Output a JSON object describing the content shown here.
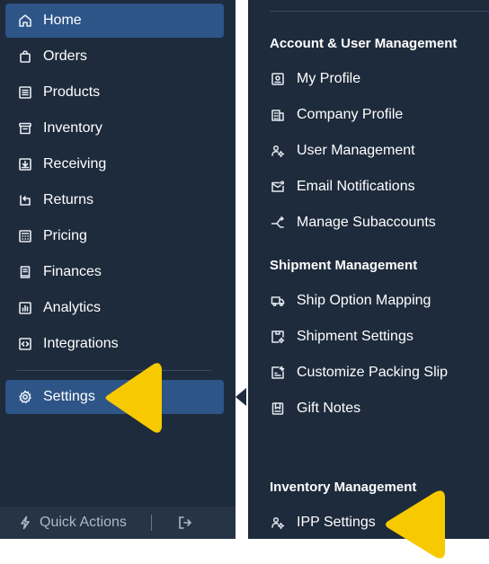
{
  "sidebar": {
    "items": [
      {
        "label": "Home",
        "icon": "home-icon",
        "active": true
      },
      {
        "label": "Orders",
        "icon": "shopping-bag-icon"
      },
      {
        "label": "Products",
        "icon": "list-icon"
      },
      {
        "label": "Inventory",
        "icon": "archive-box-icon"
      },
      {
        "label": "Receiving",
        "icon": "inbox-download-icon"
      },
      {
        "label": "Returns",
        "icon": "return-arrow-icon"
      },
      {
        "label": "Pricing",
        "icon": "calculator-icon"
      },
      {
        "label": "Finances",
        "icon": "receipt-icon"
      },
      {
        "label": "Analytics",
        "icon": "bar-chart-icon"
      },
      {
        "label": "Integrations",
        "icon": "code-brackets-icon"
      }
    ],
    "settings": {
      "label": "Settings",
      "icon": "gear-icon",
      "active": true
    },
    "footer": {
      "quick_actions_label": "Quick Actions"
    }
  },
  "panel": {
    "sections": [
      {
        "heading": "Account & User Management",
        "items": [
          {
            "label": "My Profile",
            "icon": "id-card-icon"
          },
          {
            "label": "Company Profile",
            "icon": "building-icon"
          },
          {
            "label": "User Management",
            "icon": "user-gear-icon"
          },
          {
            "label": "Email Notifications",
            "icon": "mail-icon"
          },
          {
            "label": "Manage Subaccounts",
            "icon": "branch-icon"
          }
        ]
      },
      {
        "heading": "Shipment Management",
        "items": [
          {
            "label": "Ship Option Mapping",
            "icon": "truck-icon"
          },
          {
            "label": "Shipment Settings",
            "icon": "package-settings-icon"
          },
          {
            "label": "Customize Packing Slip",
            "icon": "slip-edit-icon"
          },
          {
            "label": "Gift Notes",
            "icon": "gift-note-icon"
          }
        ]
      },
      {
        "heading": "Inventory Management",
        "items": [
          {
            "label": "IPP Settings",
            "icon": "user-gear-icon"
          }
        ]
      }
    ]
  },
  "colors": {
    "sidebar_bg": "#1e2b3c",
    "active_bg": "#2d5588",
    "text": "#ffffff",
    "muted_text": "#aeb8c6",
    "annotation_arrow": "#f7c900"
  }
}
